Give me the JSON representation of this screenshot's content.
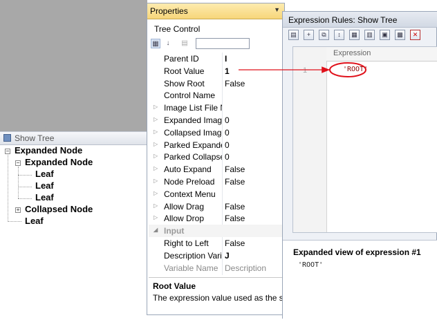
{
  "show_tree": {
    "title": "Show Tree",
    "nodes": [
      {
        "label": "Expanded Node",
        "toggle": "−"
      },
      {
        "label": "Expanded Node",
        "toggle": "−"
      },
      {
        "label": "Leaf"
      },
      {
        "label": "Leaf"
      },
      {
        "label": "Leaf"
      },
      {
        "label": "Collapsed Node",
        "toggle": "+"
      },
      {
        "label": "Leaf"
      }
    ]
  },
  "properties": {
    "title": "Properties",
    "object": "Tree Control",
    "rows": [
      {
        "name": "Parent ID",
        "value": "I",
        "expander": ""
      },
      {
        "name": "Root Value",
        "value": "1",
        "expander": ""
      },
      {
        "name": "Show Root",
        "value": "False",
        "expander": ""
      },
      {
        "name": "Control Name",
        "value": "",
        "expander": ""
      },
      {
        "name": "Image List File N",
        "value": "",
        "expander": "▷"
      },
      {
        "name": "Expanded Image",
        "value": "0",
        "expander": "▷"
      },
      {
        "name": "Collapsed Image",
        "value": "0",
        "expander": "▷"
      },
      {
        "name": "Parked Expanded",
        "value": "0",
        "expander": "▷"
      },
      {
        "name": "Parked Collapsed",
        "value": "0",
        "expander": "▷"
      },
      {
        "name": "Auto Expand",
        "value": "False",
        "expander": "▷"
      },
      {
        "name": "Node Preload",
        "value": "False",
        "expander": "▷"
      },
      {
        "name": "Context Menu",
        "value": "",
        "expander": "▷"
      },
      {
        "name": "Allow Drag",
        "value": "False",
        "expander": "▷"
      },
      {
        "name": "Allow Drop",
        "value": "False",
        "expander": "▷"
      },
      {
        "name": "Input",
        "value": "",
        "expander": "◢"
      },
      {
        "name": "Right to Left",
        "value": "False",
        "expander": ""
      },
      {
        "name": "Description Vari",
        "value": "J",
        "expander": ""
      },
      {
        "name": "Variable Name",
        "value": "Description",
        "expander": ""
      }
    ],
    "description_title": "Root Value",
    "description_text": "The expression value used as the star"
  },
  "expression_rules": {
    "title": "Expression Rules: Show Tree",
    "column_header": "Expression",
    "row_number": "1",
    "expression": "'ROOT'",
    "expanded_label": "Expanded view of expression #1",
    "expanded_value": "'ROOT'"
  },
  "colors": {
    "annotation": "#e0101a",
    "properties_title": "#f7d67a"
  }
}
